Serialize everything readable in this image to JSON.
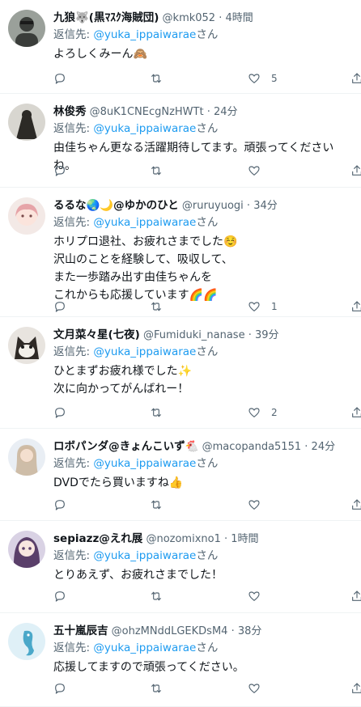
{
  "tweets": [
    {
      "name": "九狼🐺(黒ﾏｽｸ海賊団)",
      "handle": "@kmk052",
      "sep": "·",
      "time": "4時間",
      "reply_prefix": "返信先: ",
      "reply_to": "@yuka_ippaiwarae",
      "reply_suffix": "さん",
      "text": "よろしくみーん🙈",
      "replies": "",
      "retweets": "",
      "likes": "5",
      "avatar": {
        "icon": "person-avatar",
        "bg": "#9aa09a",
        "fg": "#3a3d3a"
      }
    },
    {
      "name": "林俊秀",
      "handle": "@8uK1CNEcgNzHWTt",
      "sep": "·",
      "time": "24分",
      "reply_prefix": "返信先: ",
      "reply_to": "@yuka_ippaiwarae",
      "reply_suffix": "さん",
      "text": "由佳ちゃん更なる活躍期待してます。頑張ってくださいね。",
      "replies": "",
      "retweets": "",
      "likes": "",
      "avatar": {
        "icon": "dark-figure-avatar",
        "bg": "#d8d6d0",
        "fg": "#2c2a26"
      }
    },
    {
      "name": "るるな🌏🌙@ゆかのひと",
      "handle": "@ruruyuogi",
      "sep": "·",
      "time": "34分",
      "reply_prefix": "返信先: ",
      "reply_to": "@yuka_ippaiwarae",
      "reply_suffix": "さん",
      "text": "ホリプロ退社、お疲れさまでした☺️\n沢山のことを経験して、吸収して、\nまた一歩踏み出す由佳ちゃんを\nこれからも応援しています🌈🌈",
      "replies": "",
      "retweets": "",
      "likes": "1",
      "avatar": {
        "icon": "illustrated-girl-avatar",
        "bg": "#f3e9e6",
        "fg": "#e6a4a8"
      }
    },
    {
      "name": "文月菜々星(七夜)",
      "handle": "@Fumiduki_nanase",
      "sep": "·",
      "time": "39分",
      "reply_prefix": "返信先: ",
      "reply_to": "@yuka_ippaiwarae",
      "reply_suffix": "さん",
      "text": "ひとまずお疲れ様でした✨\n次に向かってがんばれー！",
      "replies": "",
      "retweets": "",
      "likes": "2",
      "avatar": {
        "icon": "cat-avatar",
        "bg": "#e8e4df",
        "fg": "#2f2a26"
      }
    },
    {
      "name": "ロボパンダ@きょんこいず🐔",
      "handle": "@macopanda5151",
      "sep": "·",
      "time": "24分",
      "reply_prefix": "返信先: ",
      "reply_to": "@yuka_ippaiwarae",
      "reply_suffix": "さん",
      "text": "DVDでたら買いますね👍",
      "replies": "",
      "retweets": "",
      "likes": "",
      "avatar": {
        "icon": "photo-person-avatar",
        "bg": "#e9eef4",
        "fg": "#c9b49a"
      }
    },
    {
      "name": "sepiazz@えれ展",
      "handle": "@nozomixno1",
      "sep": "·",
      "time": "1時間",
      "reply_prefix": "返信先: ",
      "reply_to": "@yuka_ippaiwarae",
      "reply_suffix": "さん",
      "text": "とりあえず、お疲れさまでした！",
      "replies": "",
      "retweets": "",
      "likes": "",
      "avatar": {
        "icon": "anime-girl-avatar",
        "bg": "#d9d2e4",
        "fg": "#5a3f6a"
      }
    },
    {
      "name": "五十嵐辰吉",
      "handle": "@ohzMNddLGEKDsM4",
      "sep": "·",
      "time": "38分",
      "reply_prefix": "返信先: ",
      "reply_to": "@yuka_ippaiwarae",
      "reply_suffix": "さん",
      "text": "応援してますので頑張ってください。",
      "replies": "",
      "retweets": "",
      "likes": "",
      "avatar": {
        "icon": "seahorse-avatar",
        "bg": "#dff0f7",
        "fg": "#4aa8c9"
      }
    }
  ],
  "colors": {
    "accent": "#1d9bf0",
    "secondary_text": "#536471",
    "primary_text": "#0f1419",
    "divider": "#eff3f4"
  }
}
